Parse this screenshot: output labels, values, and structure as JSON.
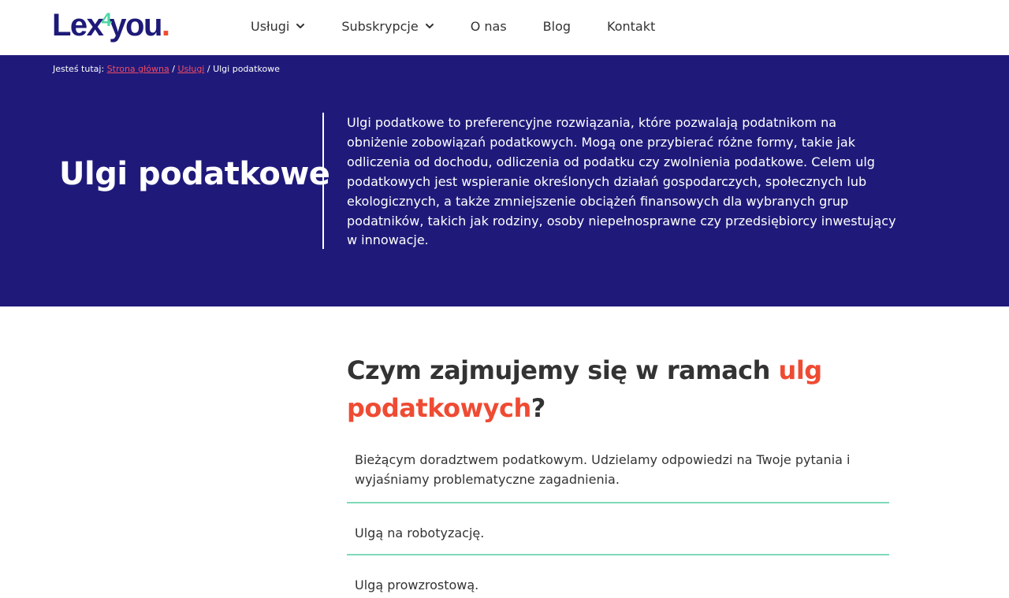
{
  "header": {
    "logo": {
      "part1": "Lex",
      "part2": "4",
      "part3": "you",
      "part4": "."
    },
    "nav": [
      {
        "label": "Usługi",
        "has_dropdown": true
      },
      {
        "label": "Subskrypcje",
        "has_dropdown": true
      },
      {
        "label": "O nas",
        "has_dropdown": false
      },
      {
        "label": "Blog",
        "has_dropdown": false
      },
      {
        "label": "Kontakt",
        "has_dropdown": false
      }
    ]
  },
  "breadcrumb": {
    "prefix": "Jesteś tutaj:",
    "home": "Strona główna",
    "sep1": "/",
    "parent": "Usługi",
    "sep2": "/",
    "current": "Ulgi podatkowe"
  },
  "hero": {
    "title": "Ulgi podatkowe",
    "description": "Ulgi podatkowe to preferencyjne rozwiązania, które pozwalają podatnikom na obniżenie zobowiązań podatkowych. Mogą one przybierać różne formy, takie jak odliczenia od dochodu, odliczenia od podatku czy zwolnienia podatkowe. Celem ulg podatkowych jest wspieranie określonych działań gospodarczych, społecznych lub ekologicznych, a także zmniejszenie obciążeń finansowych dla wybranych grup podatników, takich jak rodziny, osoby niepełnosprawne czy przedsiębiorcy inwestujący w innowacje."
  },
  "section": {
    "title_start": "Czym zajmujemy się w ramach ",
    "title_accent": "ulg podatkowych",
    "title_end": "?",
    "items": [
      "Bieżącym doradztwem podatkowym. Udzielamy odpowiedzi na Twoje pytania i wyjaśniamy problematyczne zagadnienia.",
      "Ulgą na robotyzację.",
      "Ulgą prowzrostową."
    ]
  },
  "colors": {
    "brand_navy": "#1f1a7a",
    "accent_red": "#ef4b33",
    "accent_mint": "#4fd6a4",
    "divider_mint": "#7fd9b8"
  }
}
